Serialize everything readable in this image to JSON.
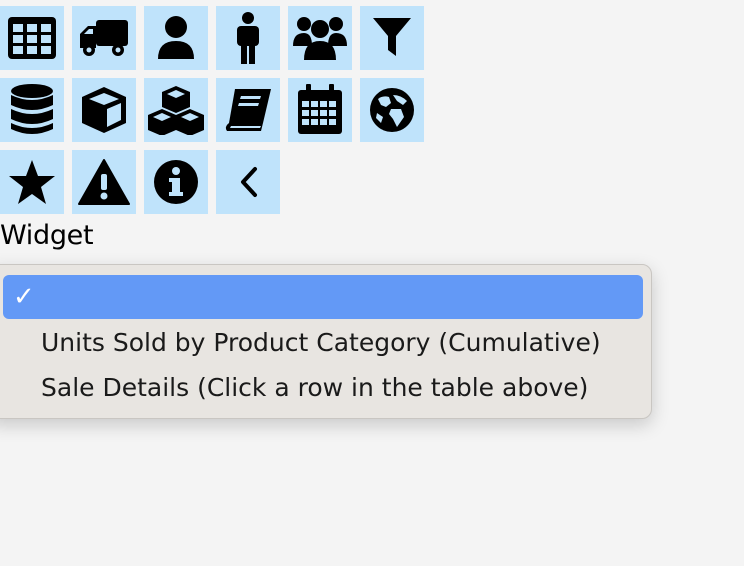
{
  "icons": {
    "rows": [
      [
        "table-icon",
        "truck-icon",
        "user-icon",
        "male-icon",
        "users-icon",
        "filter-icon"
      ],
      [
        "database-icon",
        "cube-icon",
        "cubes-icon",
        "book-icon",
        "calendar-icon",
        "globe-icon"
      ],
      [
        "star-icon",
        "warning-icon",
        "info-icon",
        "chevron-left-icon"
      ]
    ],
    "tile_color": "#bfe3fb"
  },
  "widget": {
    "label": "Widget",
    "dropdown": {
      "selected_index": 0,
      "selected_color": "#6399f6",
      "checkmark": "✓",
      "options": [
        "",
        "Units Sold by Product Category (Cumulative)",
        "Sale Details (Click a row in the table above)"
      ]
    }
  }
}
